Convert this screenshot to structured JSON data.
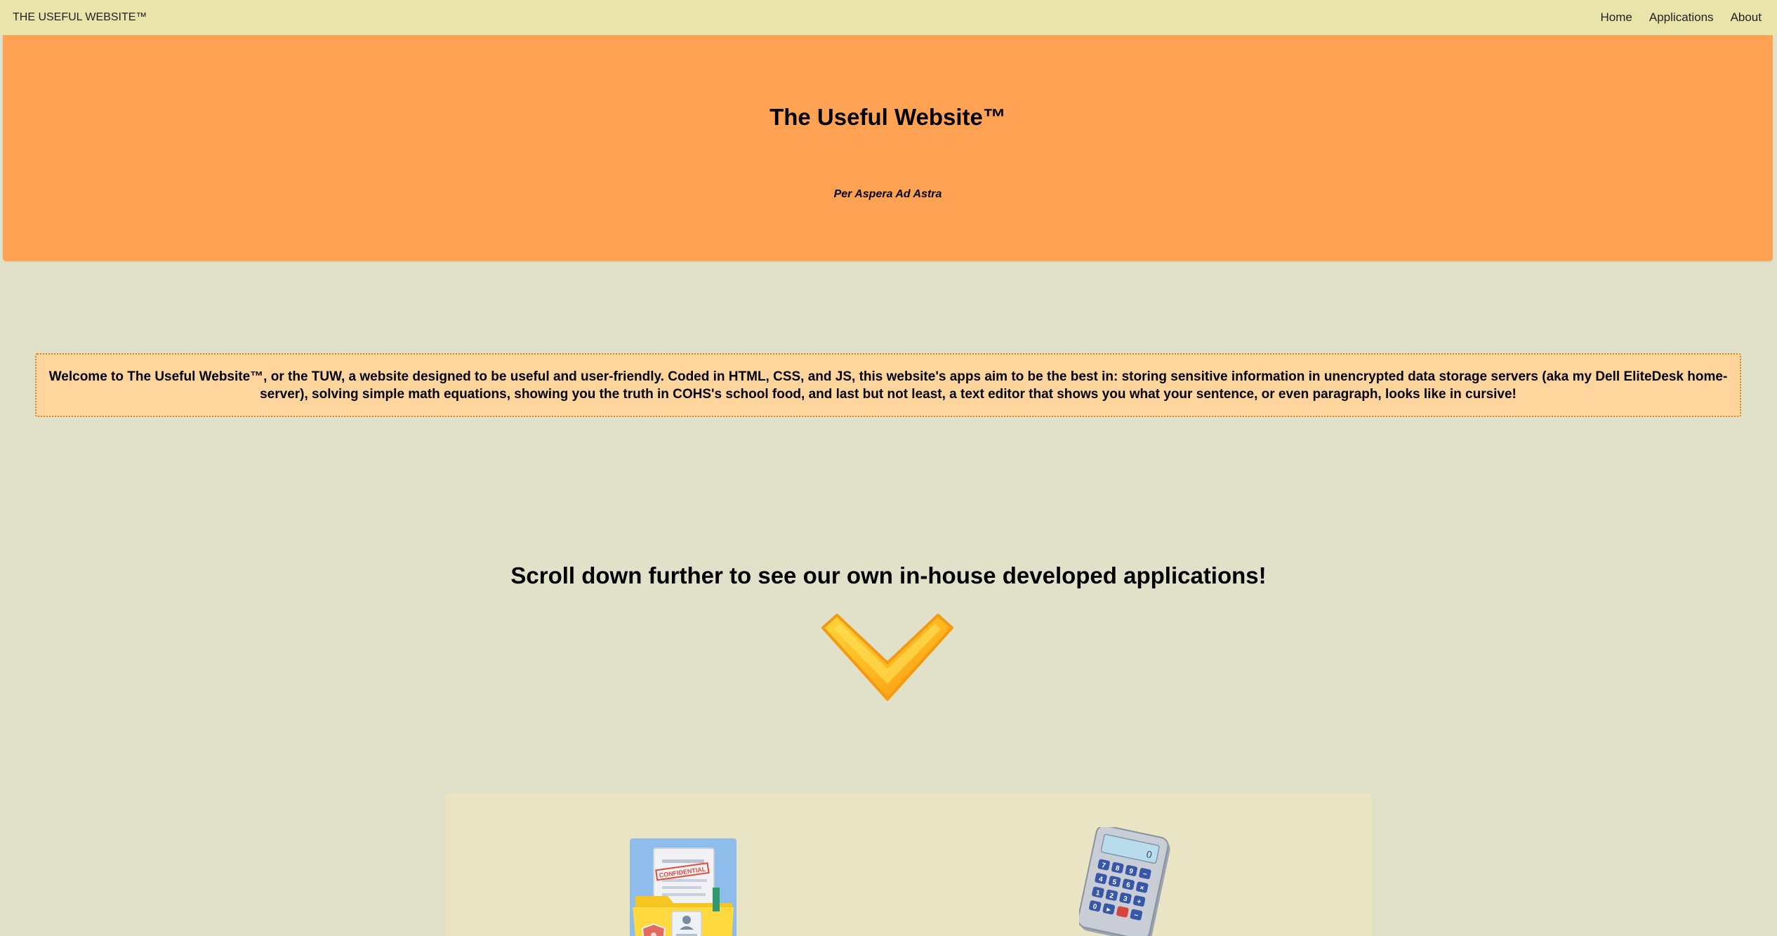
{
  "navbar": {
    "brand": "THE USEFUL WEBSITE™",
    "links": [
      "Home",
      "Applications",
      "About"
    ]
  },
  "hero": {
    "title": "The Useful Website™",
    "tagline": "Per Aspera Ad Astra"
  },
  "intro": {
    "text": "Welcome to The Useful Website™, or the TUW, a website designed to be useful and user-friendly. Coded in HTML, CSS, and JS, this website's apps aim to be the best in: storing sensitive information in unencrypted data storage servers (aka my Dell EliteDesk home-server), solving simple math equations, showing you the truth in COHS's school food, and last but not least, a text editor that shows you what your sentence, or even paragraph, looks like in cursive!"
  },
  "scroll_hint": {
    "text": "Scroll down further to see our own in-house developed applications!",
    "icon": "chevron-down-icon"
  },
  "apps": [
    {
      "icon": "confidential-folder-icon",
      "stamp_text": "CONFIDENTIAL"
    },
    {
      "icon": "calculator-icon"
    }
  ],
  "colors": {
    "background": "#e1e1ca",
    "navbar": "#e9e5aa",
    "hero": "#ffa253",
    "intro_box": "#ffd59e",
    "chevron": "#ffb21d"
  }
}
